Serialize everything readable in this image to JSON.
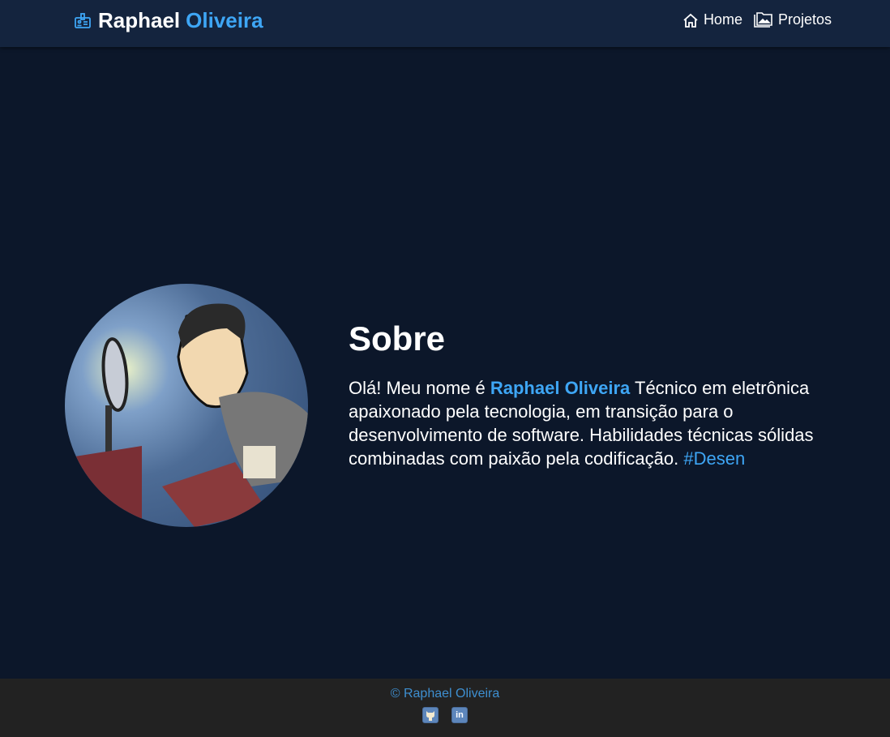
{
  "nav": {
    "brand_first": "Raphael",
    "brand_second": "Oliveira",
    "links": [
      {
        "label": "Home",
        "icon": "home-icon"
      },
      {
        "label": "Projetos",
        "icon": "folder-image-icon"
      }
    ]
  },
  "about": {
    "title": "Sobre",
    "intro": "Olá! Meu nome é ",
    "name": "Raphael Oliveira",
    "body": " Técnico em eletrônica apaixonado pela tecnologia, em transição para o desenvolvimento de software. Habilidades técnicas sólidas combinadas com paixão pela codificação. ",
    "hashtag": "#Desen"
  },
  "footer": {
    "copyright": "© Raphael Oliveira",
    "linkedin_label": "in"
  },
  "colors": {
    "accent": "#3ea6f5",
    "background": "#0c172a",
    "navbar": "#14243e",
    "footer": "#222222"
  }
}
